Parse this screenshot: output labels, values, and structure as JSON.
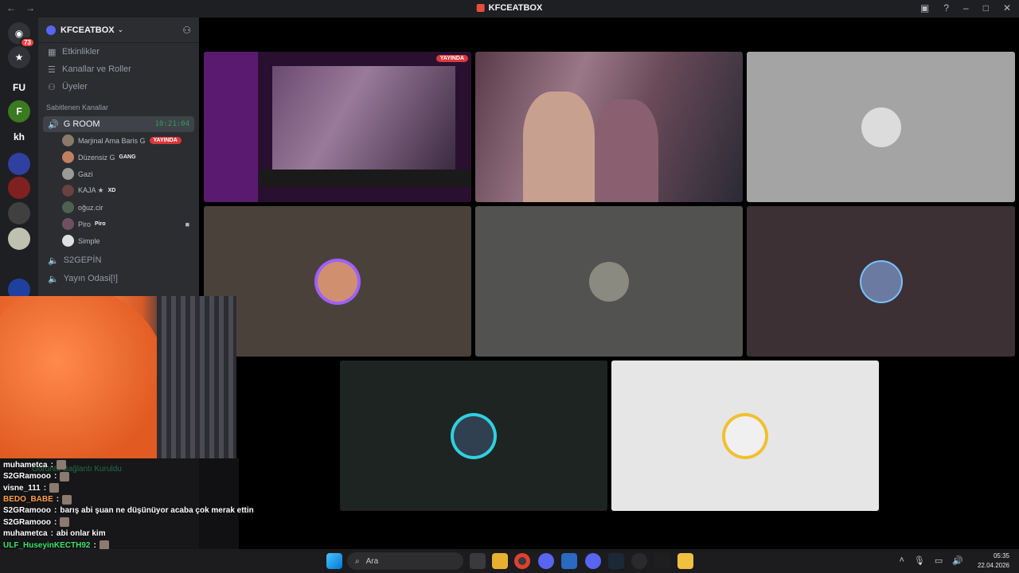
{
  "window": {
    "title": "KFCEATBOX"
  },
  "rail": {
    "mention_badge": "73",
    "kh_label": "kh"
  },
  "guild": {
    "name": "KFCEATBOX"
  },
  "nav": [
    {
      "label": "Etkinlikler",
      "icon": "calendar-icon"
    },
    {
      "label": "Kanallar ve Roller",
      "icon": "list-icon"
    },
    {
      "label": "Üyeler",
      "icon": "members-icon"
    }
  ],
  "category": "Sabitlenen Kanallar",
  "active_channel": {
    "name": "G ROOM",
    "timer": "10:21:04"
  },
  "voice_users": [
    {
      "name": "Marjinal Ama Baris G",
      "tag": "",
      "live": "YAYINDA",
      "color": "#8a7a6a"
    },
    {
      "name": "Düzensiz G",
      "tag": "GANG",
      "live": "",
      "color": "#c08060"
    },
    {
      "name": "Gazi",
      "tag": "",
      "live": "",
      "color": "#9a9a9a"
    },
    {
      "name": "KAJA ★",
      "tag": "XD",
      "live": "",
      "color": "#6a4040"
    },
    {
      "name": "oğuz.cir",
      "tag": "",
      "live": "",
      "color": "#506050"
    },
    {
      "name": "Piro",
      "tag": "Piro",
      "live": "",
      "color": "#705060"
    },
    {
      "name": "Simple",
      "tag": "",
      "live": "",
      "color": "#e0e0e0"
    }
  ],
  "other_channels": [
    "S2GEPİN",
    "Yayın Odasi[!]"
  ],
  "stream_tile": {
    "live": "YAYINDA"
  },
  "chat": {
    "ghost_status": "Görüntü Bağlantı Kuruldu",
    "messages": [
      {
        "user": "muhametca",
        "text": "",
        "color": "#ffffff"
      },
      {
        "user": "S2GRamooo",
        "text": "",
        "color": "#ffffff"
      },
      {
        "user": "visne_111",
        "text": "",
        "color": "#ffffff"
      },
      {
        "user": "BEDO_BABE",
        "text": "",
        "color": "#ff9f43"
      },
      {
        "user": "S2GRamooo",
        "text": "barış abi şuan ne düşünüyor acaba çok merak ettin",
        "color": "#ffffff"
      },
      {
        "user": "S2GRamooo",
        "text": "",
        "color": "#ffffff"
      },
      {
        "user": "muhametca",
        "text": "abi onlar kim",
        "color": "#ffffff"
      },
      {
        "user": "ULF_HuseyinKECTH92",
        "text": "",
        "color": "#3ee36b"
      }
    ]
  },
  "taskbar": {
    "search_placeholder": "Ara",
    "time": "05:35",
    "date": "22.04.2026"
  }
}
